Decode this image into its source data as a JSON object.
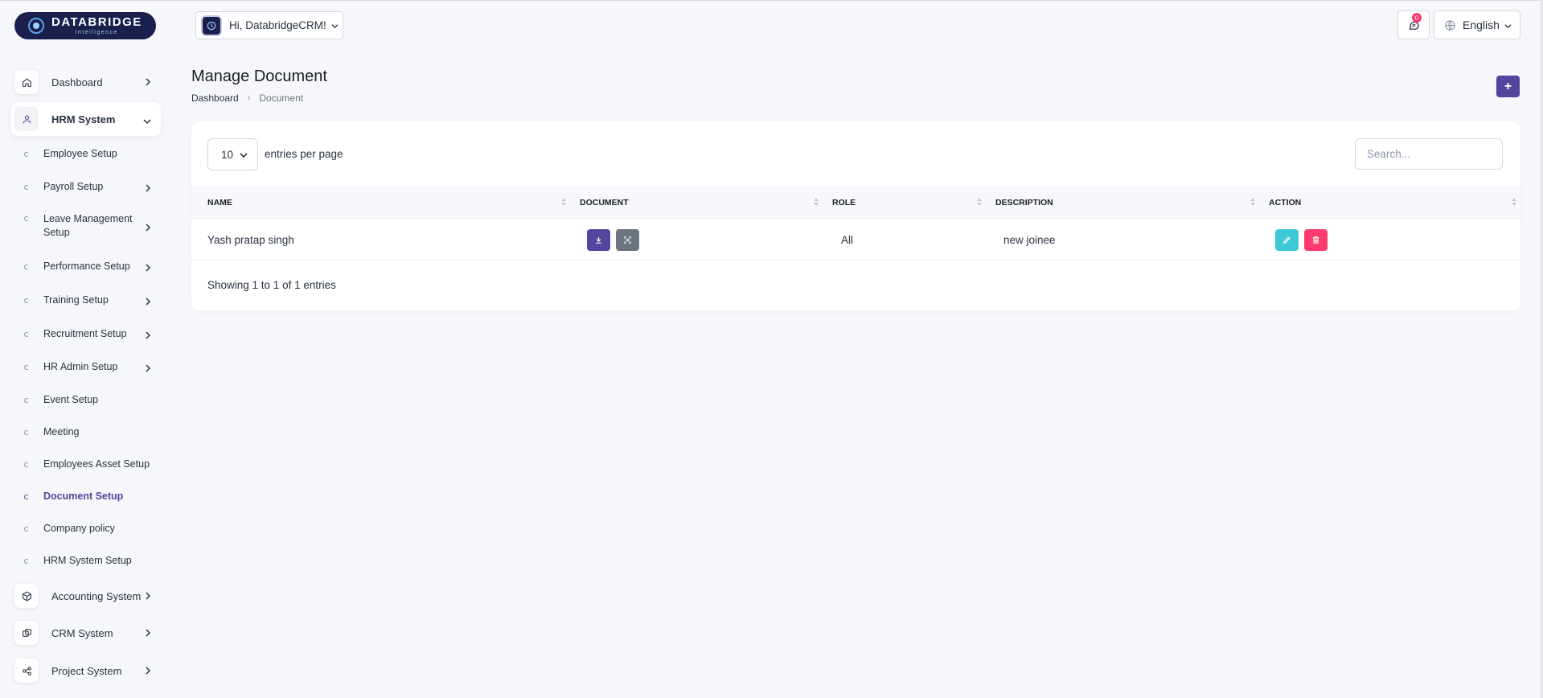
{
  "logo": {
    "title": "DATABRIDGE",
    "subtitle": "intelligence"
  },
  "header": {
    "greeting": "Hi, DatabridgeCRM!",
    "notification_count": "0",
    "language": "English"
  },
  "sidebar": {
    "top": [
      {
        "label": "Dashboard",
        "icon": "home-icon"
      },
      {
        "label": "HRM System",
        "icon": "user-icon"
      }
    ],
    "hrm_items": [
      {
        "label": "Employee Setup"
      },
      {
        "label": "Payroll Setup"
      },
      {
        "label": "Leave Management",
        "label2": "Setup"
      },
      {
        "label": "Performance Setup"
      },
      {
        "label": "Training Setup"
      },
      {
        "label": "Recruitment Setup"
      },
      {
        "label": "HR Admin Setup"
      },
      {
        "label": "Event Setup"
      },
      {
        "label": "Meeting"
      },
      {
        "label": "Employees Asset Setup"
      },
      {
        "label": "Document Setup"
      },
      {
        "label": "Company policy"
      },
      {
        "label": "HRM System Setup"
      }
    ],
    "bottom": [
      {
        "label": "Accounting System",
        "icon": "box-icon"
      },
      {
        "label": "CRM System",
        "icon": "layers-icon"
      },
      {
        "label": "Project System",
        "icon": "share-icon"
      }
    ]
  },
  "page": {
    "title": "Manage Document",
    "breadcrumb": {
      "home": "Dashboard",
      "current": "Document"
    },
    "add_label": "+"
  },
  "table": {
    "per_page": "10",
    "per_page_label": "entries per page",
    "search_placeholder": "Search...",
    "columns": [
      "NAME",
      "DOCUMENT",
      "ROLE",
      "DESCRIPTION",
      "ACTION"
    ],
    "rows": [
      {
        "name": "Yash pratap singh",
        "role": "All",
        "description": "new joinee"
      }
    ],
    "info": "Showing 1 to 1 of 1 entries"
  },
  "colors": {
    "primary": "#51459d",
    "info": "#3ec9d6",
    "danger": "#ff3a6e",
    "secondary": "#6c757d"
  }
}
